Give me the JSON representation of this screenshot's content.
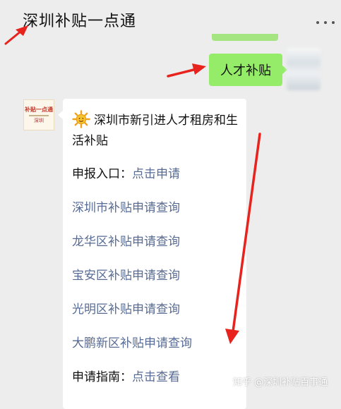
{
  "header": {
    "title": "深圳补贴一点通",
    "more_icon": "more-icon"
  },
  "chat": {
    "user_message": "人才补贴",
    "bot_avatar": {
      "line1": "补贴一点通",
      "line2": "深圳"
    },
    "card": {
      "title": "深圳市新引进人才租房和生活补贴",
      "title_icon": "sun-icon",
      "entry": {
        "label": "申报入口",
        "sep": "：",
        "link": "点击申请"
      },
      "links": [
        "深圳市补贴申请查询",
        "龙华区补贴申请查询",
        "宝安区补贴申请查询",
        "光明区补贴申请查询",
        "大鹏新区补贴申请查询"
      ],
      "guide": {
        "label": "申请指南",
        "sep": "：",
        "link": "点击查看"
      }
    }
  },
  "watermark": "知乎 @深圳补贴百事通",
  "colors": {
    "background": "#ededed",
    "user_bubble": "#95ec69",
    "link": "#576b95",
    "annotation_arrow": "#e8231d"
  }
}
